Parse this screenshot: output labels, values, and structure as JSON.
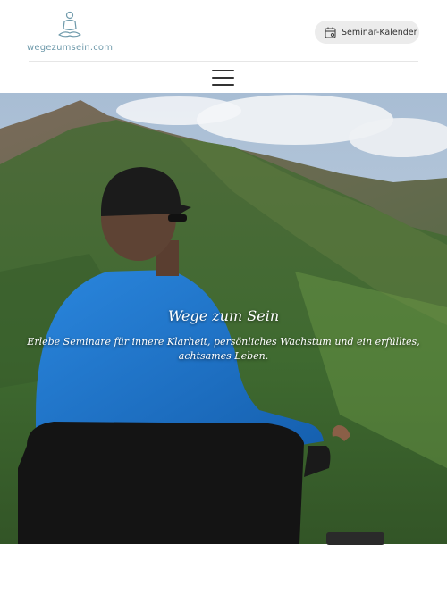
{
  "header": {
    "logo_text": "wegezumsein.com",
    "logo_icon": "meditation-figure-icon",
    "calendar_button_label": "Seminar-Kalender",
    "calendar_icon": "calendar-icon",
    "menu_icon": "hamburger-menu-icon"
  },
  "hero": {
    "title": "Wege zum Sein",
    "subtitle": "Erlebe Seminare für innere Klarheit, persönliches Wachstum und ein erfülltes, achtsames Leben."
  },
  "colors": {
    "logo_accent": "#6f9aab",
    "button_bg": "#ececec",
    "shirt": "#1e73c8"
  }
}
